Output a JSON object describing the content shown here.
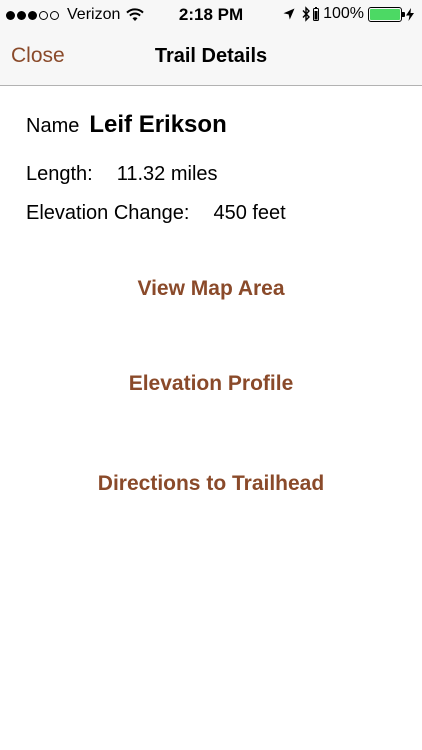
{
  "status_bar": {
    "carrier": "Verizon",
    "time": "2:18 PM",
    "battery_percent": "100%",
    "battery_level": 1.0,
    "signal_bars_filled": 3,
    "signal_bars_total": 5,
    "battery_color": "#4cd964"
  },
  "nav": {
    "close_label": "Close",
    "title": "Trail Details"
  },
  "trail": {
    "name_label": "Name",
    "name": "Leif Erikson",
    "length_label": "Length:",
    "length_value": "11.32 miles",
    "elevation_label": "Elevation Change:",
    "elevation_value": "450 feet"
  },
  "actions": {
    "view_map": "View Map Area",
    "elevation_profile": "Elevation Profile",
    "directions": "Directions to Trailhead"
  },
  "colors": {
    "accent": "#8a4a2a"
  }
}
